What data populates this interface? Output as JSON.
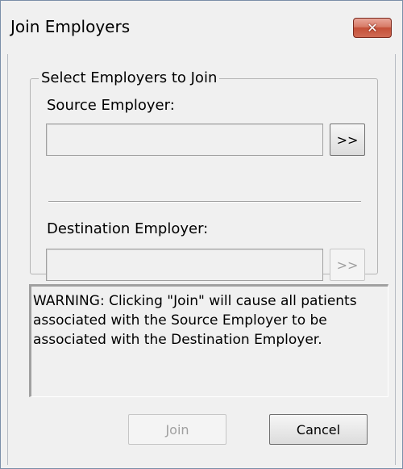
{
  "window": {
    "title": "Join Employers",
    "close_glyph": "✕"
  },
  "group": {
    "legend": "Select Employers to Join"
  },
  "source": {
    "label": "Source Employer:",
    "value": "",
    "pick_button_label": ">>",
    "pick_button_enabled": true
  },
  "destination": {
    "label": "Destination Employer:",
    "value": "",
    "pick_button_label": ">>",
    "pick_button_enabled": false
  },
  "warning": {
    "text": "WARNING: Clicking \"Join\" will cause all patients associated with the Source Employer to be associated with the Destination Employer."
  },
  "actions": {
    "join_label": "Join",
    "join_enabled": false,
    "cancel_label": "Cancel"
  }
}
